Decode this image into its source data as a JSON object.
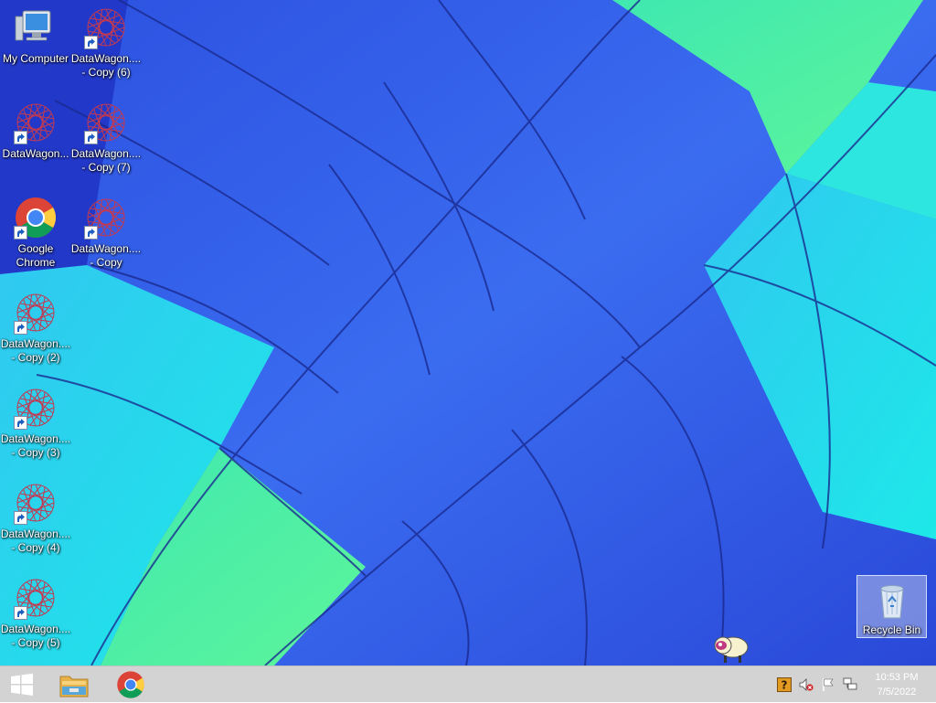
{
  "desktop": {
    "icons": [
      {
        "id": "my-computer",
        "label": "My Computer",
        "type": "computer"
      },
      {
        "id": "datawagon-copy-6",
        "label": "DataWagon....\n- Copy (6)",
        "type": "datawagon"
      },
      {
        "id": "datawagon",
        "label": "DataWagon...",
        "type": "datawagon"
      },
      {
        "id": "datawagon-copy-7",
        "label": "DataWagon....\n- Copy (7)",
        "type": "datawagon"
      },
      {
        "id": "google-chrome",
        "label": "Google\nChrome",
        "type": "chrome"
      },
      {
        "id": "datawagon-copy",
        "label": "DataWagon....\n- Copy",
        "type": "datawagon"
      },
      {
        "id": "datawagon-copy-2",
        "label": "DataWagon....\n- Copy (2)",
        "type": "datawagon"
      },
      {
        "id": "datawagon-copy-3",
        "label": "DataWagon....\n- Copy (3)",
        "type": "datawagon"
      },
      {
        "id": "datawagon-copy-4",
        "label": "DataWagon....\n- Copy (4)",
        "type": "datawagon"
      },
      {
        "id": "datawagon-copy-5",
        "label": "DataWagon....\n- Copy (5)",
        "type": "datawagon"
      }
    ],
    "recycle_bin": {
      "label": "Recycle Bin",
      "selected": true
    }
  },
  "taskbar": {
    "pinned": [
      {
        "id": "start",
        "icon": "windows-logo-icon"
      },
      {
        "id": "file-explorer",
        "icon": "folder-icon"
      },
      {
        "id": "chrome",
        "icon": "chrome-icon"
      }
    ],
    "tray": {
      "icons": [
        "help-icon",
        "speaker-muted-icon",
        "action-center-flag-icon",
        "network-icon"
      ]
    },
    "clock": {
      "time": "10:53 PM",
      "date": "7/5/2022"
    }
  },
  "colors": {
    "wallpaper_blue": "#2f5de8",
    "wallpaper_cyan": "#22e0e8",
    "wallpaper_green": "#4cf2a4",
    "taskbar": "#d3d3d3",
    "datawagon_red": "#c23a52"
  }
}
